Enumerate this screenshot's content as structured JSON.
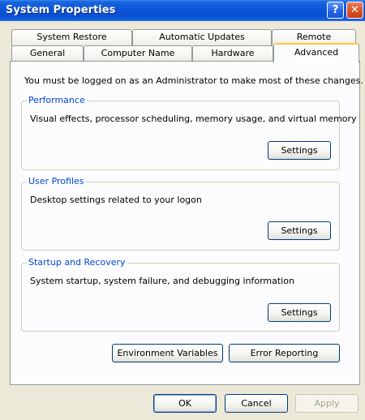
{
  "window": {
    "title": "System Properties",
    "help_glyph": "?",
    "close_glyph": "✕"
  },
  "tabs": {
    "row1": [
      "System Restore",
      "Automatic Updates",
      "Remote"
    ],
    "row2": [
      "General",
      "Computer Name",
      "Hardware",
      "Advanced"
    ],
    "active": "Advanced"
  },
  "notice": "You must be logged on as an Administrator to make most of these changes.",
  "groups": [
    {
      "title": "Performance",
      "description": "Visual effects, processor scheduling, memory usage, and virtual memory",
      "button": "Settings"
    },
    {
      "title": "User Profiles",
      "description": "Desktop settings related to your logon",
      "button": "Settings"
    },
    {
      "title": "Startup and Recovery",
      "description": "System startup, system failure, and debugging information",
      "button": "Settings"
    }
  ],
  "extra_buttons": {
    "environment": "Environment Variables",
    "error_reporting": "Error Reporting"
  },
  "footer": {
    "ok": "OK",
    "cancel": "Cancel",
    "apply": "Apply"
  },
  "colors": {
    "title_bar": "#0a4fd0",
    "group_title": "#0046d5",
    "active_tab_accent": "#ffc83c",
    "close_button": "#d84e25"
  }
}
